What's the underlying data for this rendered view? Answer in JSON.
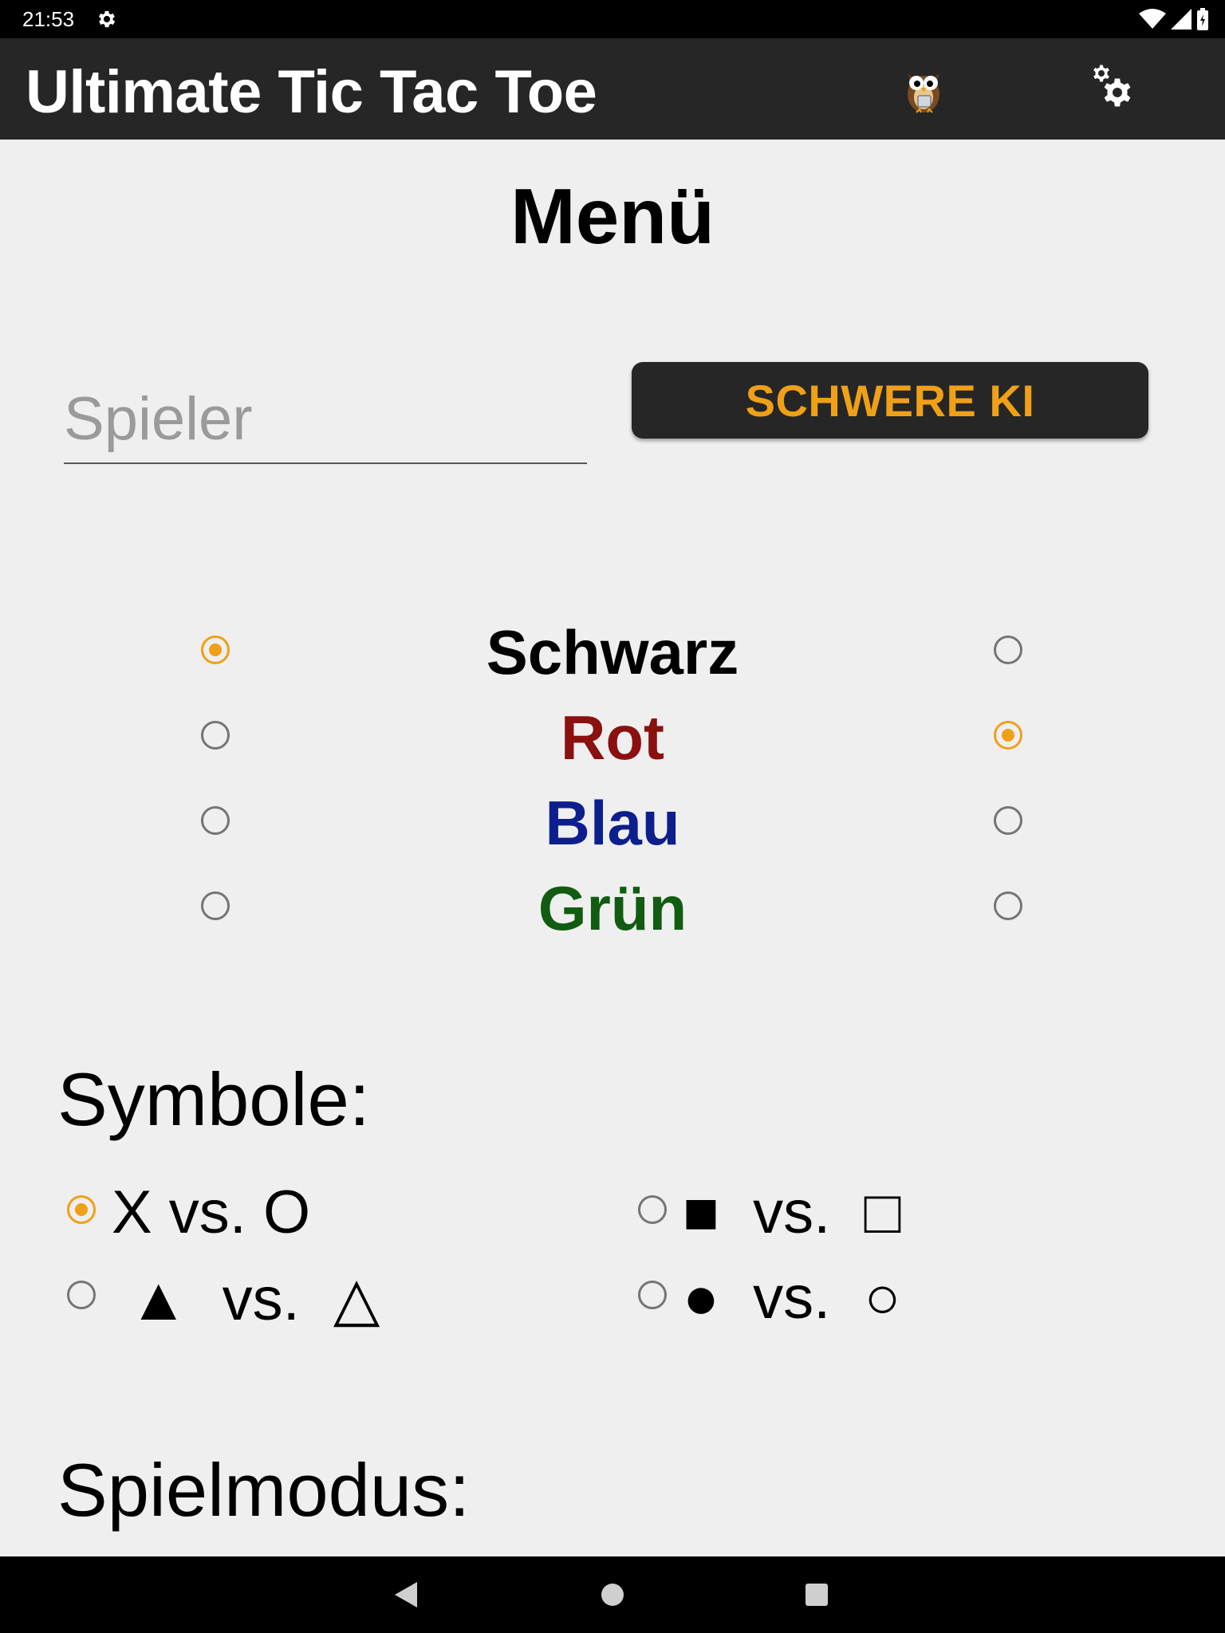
{
  "status_bar": {
    "time": "21:53"
  },
  "app_bar": {
    "title": "Ultimate Tic Tac Toe"
  },
  "menu": {
    "title": "Menü"
  },
  "player": {
    "placeholder": "Spieler",
    "value": ""
  },
  "ai_button": {
    "label": "SCHWERE KI"
  },
  "colors": [
    {
      "label": "Schwarz",
      "color": "#000000",
      "left_selected": true,
      "right_selected": false
    },
    {
      "label": "Rot",
      "color": "#8b1010",
      "left_selected": false,
      "right_selected": true
    },
    {
      "label": "Blau",
      "color": "#0d1f8c",
      "left_selected": false,
      "right_selected": false
    },
    {
      "label": "Grün",
      "color": "#115c11",
      "left_selected": false,
      "right_selected": false
    }
  ],
  "symbols": {
    "heading": "Symbole:",
    "options": [
      {
        "label": "X vs. O",
        "selected": true
      },
      {
        "label": "■  vs.  □",
        "selected": false
      },
      {
        "label": " ▲  vs.  △",
        "selected": false
      },
      {
        "label": "●  vs.  ○",
        "selected": false
      }
    ]
  },
  "mode": {
    "heading": "Spielmodus:"
  },
  "accent_color": "#f0a017"
}
